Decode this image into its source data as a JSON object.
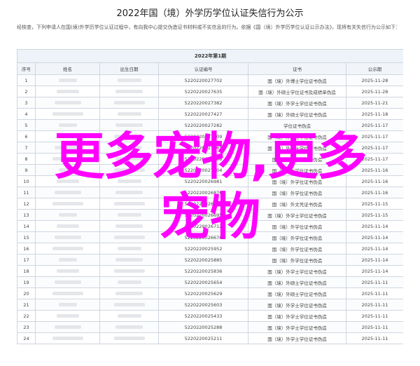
{
  "doc_title": "2022年国（境）外学历学位认证失信行为公示",
  "intro": "经核查，下列申请人在国(境)外学历学位认证过程中，有向我中心提交伪造证书材料或不实信息的行为。依据《国（境）外学历学位认证公示办法》，现将有关失信行为公示如下：",
  "table": {
    "caption": "2022年第1期",
    "headers": [
      "序号",
      "姓名",
      "出生日期",
      "认证编号",
      "证书",
      "公示期"
    ],
    "rows": [
      [
        "1",
        "5220220027702",
        "国（境）外博士学位证书伪造",
        "2025-11-28"
      ],
      [
        "2",
        "5220220027635",
        "国（境）外硕士学位证书及成绩单伪造",
        "2025-11-28"
      ],
      [
        "3",
        "5220220027382",
        "国（境）外学士学位证书伪造",
        "2025-11-21"
      ],
      [
        "4",
        "5220220027427",
        "国（境）外硕士学位证书伪造",
        "2025-11-18"
      ],
      [
        "5",
        "5220220027282",
        "学位证书伪造",
        "2025-11-17"
      ],
      [
        "6",
        "5220220027209",
        "国（境）外学士学位证书伪造",
        "2025-11-17"
      ],
      [
        "7",
        "5220220027165",
        "国（境）外硕士学位证书伪造",
        "2025-11-17"
      ],
      [
        "8",
        "5220220027158",
        "国（境）外学位证书伪造",
        "2025-11-17"
      ],
      [
        "9",
        "5220220027104",
        "国（境）外学位证书伪造",
        "2025-11-16"
      ],
      [
        "10",
        "5220220026981",
        "国（境）外学位证书伪造",
        "2025-11-16"
      ],
      [
        "11",
        "5220220026876",
        "国（境）外学位证书伪造",
        "2025-11-16"
      ],
      [
        "12",
        "5220220026843",
        "国（境）外文凭证书伪造",
        "2025-11-15"
      ],
      [
        "13",
        "5220220026695",
        "国（境）外学士学位证书伪造",
        "2025-11-15"
      ],
      [
        "14",
        "5220220026712",
        "国（境）外学位证书伪造",
        "2025-11-14"
      ],
      [
        "15",
        "5220220026676",
        "国（境）外学位证书伪造",
        "2025-11-14"
      ],
      [
        "16",
        "5220220025952",
        "国（境）外学位证书伪造",
        "2025-11-14"
      ],
      [
        "17",
        "5220220025885",
        "国（境）外学位证书伪造",
        "2025-11-14"
      ],
      [
        "18",
        "5220220025836",
        "国（境）外学士学位证书伪造",
        "2025-11-14"
      ],
      [
        "19",
        "5220220025654",
        "国（境）外硕士学位证书伪造",
        "2025-11-11"
      ],
      [
        "20",
        "5220220025629",
        "国（境）外硕士学位证书伪造",
        "2025-11-11"
      ],
      [
        "21",
        "5220220025603",
        "国（境）外学士学位证书伪造",
        "2025-11-11"
      ],
      [
        "22",
        "5220220025433",
        "国（境）外学士学位证书伪造",
        "2025-11-11"
      ],
      [
        "23",
        "5220220025288",
        "国（境）外学士学位证书伪造",
        "2025-11-11"
      ],
      [
        "24",
        "5220220025211",
        "国（境）外学士学位证书伪造",
        "2025-11-11"
      ]
    ]
  },
  "watermark": {
    "line1": "更多宠物,更多",
    "line2": "宠物",
    "color": "#ff00ff"
  }
}
